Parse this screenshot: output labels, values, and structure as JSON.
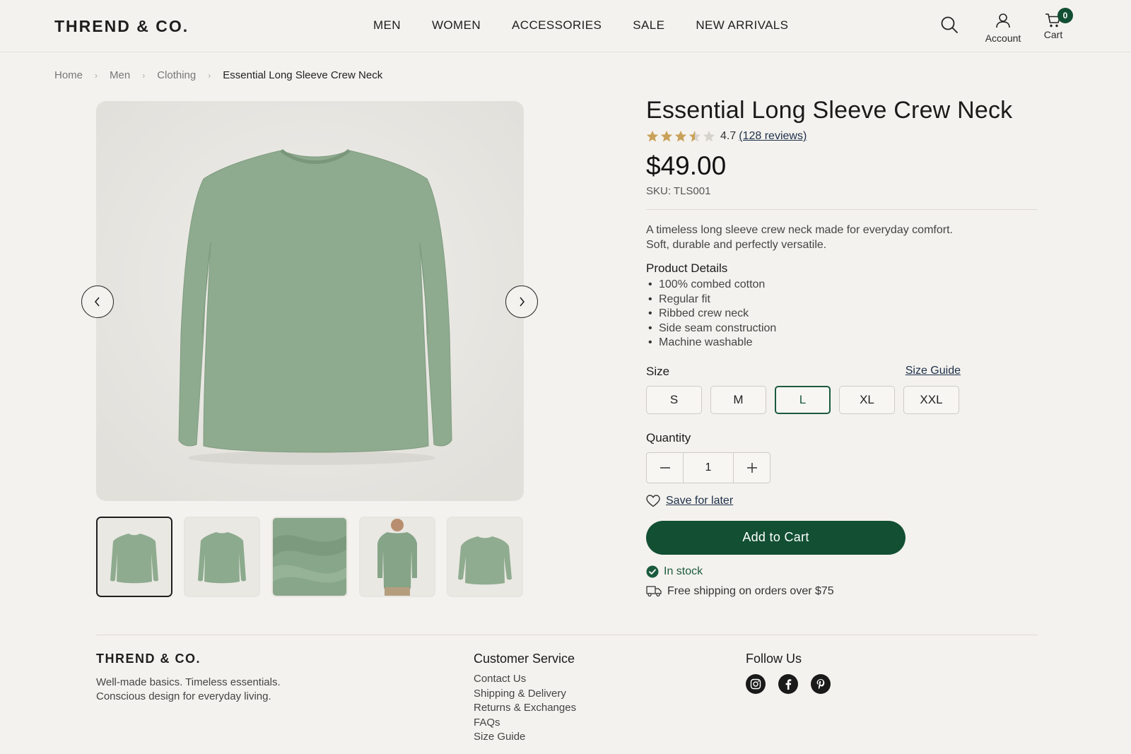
{
  "header": {
    "logo": "THREND & CO.",
    "nav": [
      "MEN",
      "WOMEN",
      "ACCESSORIES",
      "SALE",
      "NEW ARRIVALS"
    ],
    "account_label": "Account",
    "cart_label": "Cart",
    "cart_count": "0"
  },
  "breadcrumb": [
    "Home",
    "Men",
    "Clothing",
    "Essential Long Sleeve Crew Neck"
  ],
  "product": {
    "title": "Essential Long Sleeve Crew Neck",
    "rating_value": "4.7",
    "rating_stars": 3.5,
    "reviews_label": "(128 reviews)",
    "price": "$49.00",
    "sku": "SKU: TLS001",
    "description": "A timeless long sleeve crew neck made for everyday comfort. Soft, durable and perfectly versatile.",
    "details_title": "Product Details",
    "details": [
      "100% combed cotton",
      "Regular fit",
      "Ribbed crew neck",
      "Side seam construction",
      "Machine washable"
    ],
    "size_label": "Size",
    "size_guide_label": "Size Guide",
    "sizes": [
      "S",
      "M",
      "L",
      "XL",
      "XXL"
    ],
    "selected_size": "L",
    "quantity_label": "Quantity",
    "quantity": "1",
    "save_later_label": "Save for later",
    "add_to_cart_label": "Add to Cart",
    "stock_label": "In stock",
    "shipping_label": "Free shipping on orders over $75"
  },
  "gallery": {
    "thumbnails": [
      "front",
      "back",
      "fabric-closeup",
      "on-model",
      "folded-front"
    ],
    "selected_thumbnail": 0
  },
  "footer": {
    "brand_name": "THREND & CO.",
    "tagline_line1": "Well-made basics. Timeless essentials.",
    "tagline_line2": "Conscious design for everyday living.",
    "customer_service_title": "Customer Service",
    "customer_service_links": [
      "Contact Us",
      "Shipping & Delivery",
      "Returns & Exchanges",
      "FAQs",
      "Size Guide"
    ],
    "follow_title": "Follow Us",
    "social": [
      "instagram-icon",
      "facebook-icon",
      "pinterest-icon"
    ]
  },
  "colors": {
    "accent": "#124f33",
    "background": "#f4f2ee",
    "shirt": "#8fab8f",
    "star": "#c9a15a"
  }
}
